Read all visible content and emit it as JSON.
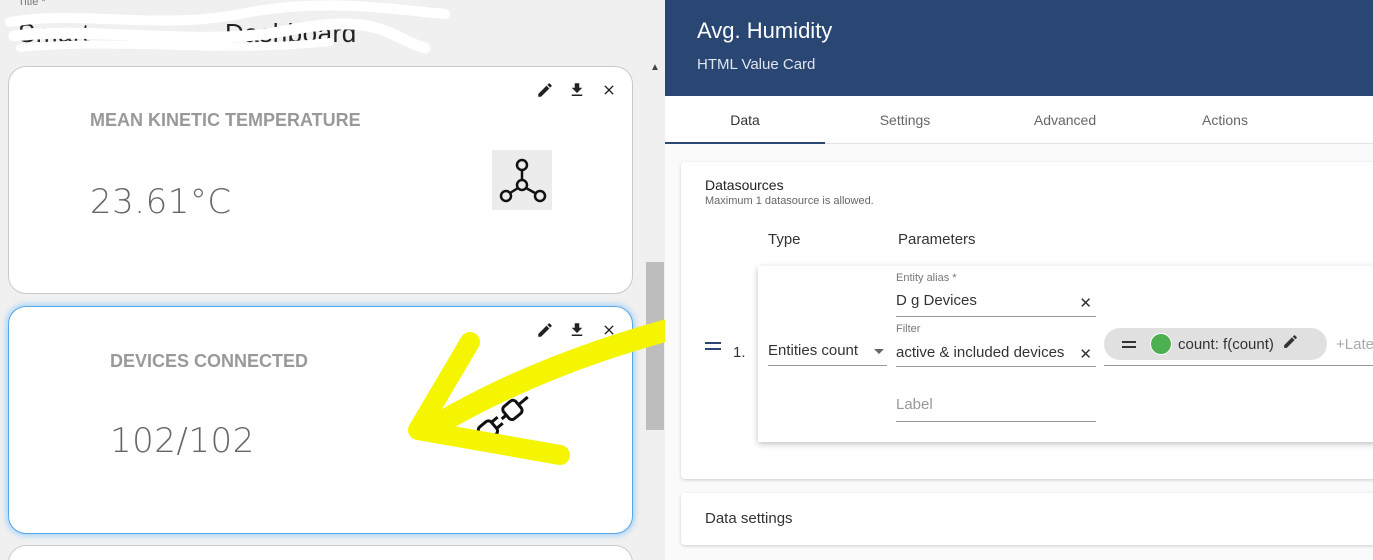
{
  "left": {
    "title_label": "Title *",
    "title_value": "Smart ________ Dashboard",
    "cards": [
      {
        "label": "MEAN KINETIC TEMPERATURE",
        "value": "23.61°C",
        "icon": "molecule-icon"
      },
      {
        "label": "DEVICES CONNECTED",
        "value": "102/102",
        "icon": "plug-icon"
      }
    ]
  },
  "editor": {
    "title": "Avg. Humidity",
    "subtitle": "HTML Value Card",
    "tabs": [
      {
        "label": "Data",
        "active": true
      },
      {
        "label": "Settings"
      },
      {
        "label": "Advanced"
      },
      {
        "label": "Actions"
      }
    ],
    "datasources": {
      "title": "Datasources",
      "hint": "Maximum 1 datasource is allowed.",
      "col_type": "Type",
      "col_params": "Parameters",
      "rows": [
        {
          "index": "1.",
          "type": "Entities count",
          "entity_alias_label": "Entity alias *",
          "entity_alias": "D  g   Devices",
          "filter_label": "Filter",
          "filter": "active & included devices",
          "label_placeholder": "Label",
          "key_chip": "count: f(count)",
          "key_chip_color": "#4caf50",
          "keys_more": "+Latest key"
        }
      ]
    },
    "data_settings": "Data settings"
  },
  "colors": {
    "header": "#2a4673",
    "annotation_arrow": "#ffff00",
    "selected_card_glow": "#5aa6e6"
  }
}
